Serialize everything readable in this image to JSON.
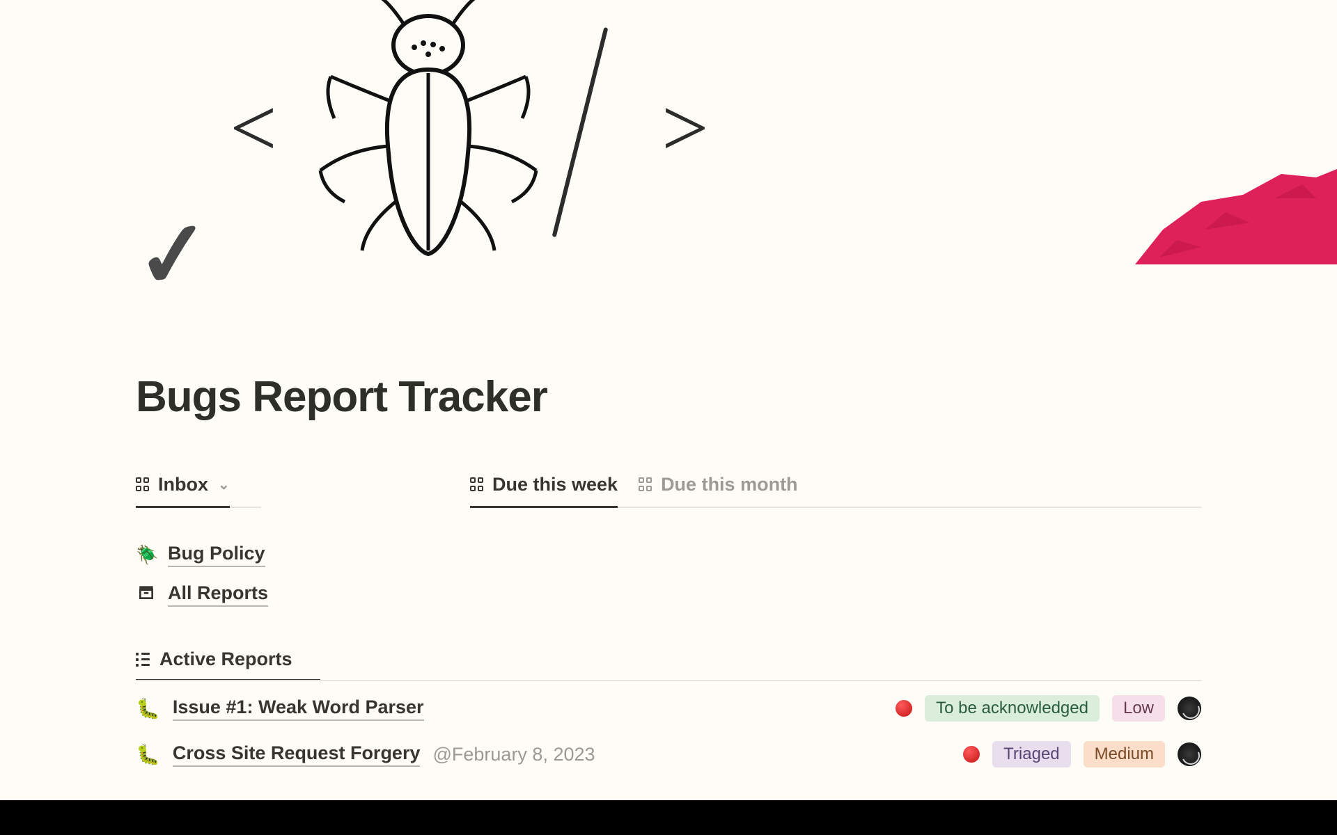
{
  "page": {
    "title": "Bugs Report Tracker"
  },
  "views": {
    "left": {
      "inbox": "Inbox"
    },
    "right": {
      "due_week": "Due this week",
      "due_month": "Due this month"
    }
  },
  "links": {
    "bug_policy": "Bug Policy",
    "all_reports": "All Reports"
  },
  "active_reports": {
    "header": "Active Reports",
    "rows": [
      {
        "title": "Issue #1: Weak Word Parser",
        "date": "",
        "status": "To be acknowledged",
        "status_class": "tag-green",
        "priority": "Low",
        "priority_class": "tag-pink"
      },
      {
        "title": "Cross Site Request Forgery",
        "date": "@February 8, 2023",
        "status": "Triaged",
        "status_class": "tag-purple",
        "priority": "Medium",
        "priority_class": "tag-orange"
      }
    ]
  }
}
